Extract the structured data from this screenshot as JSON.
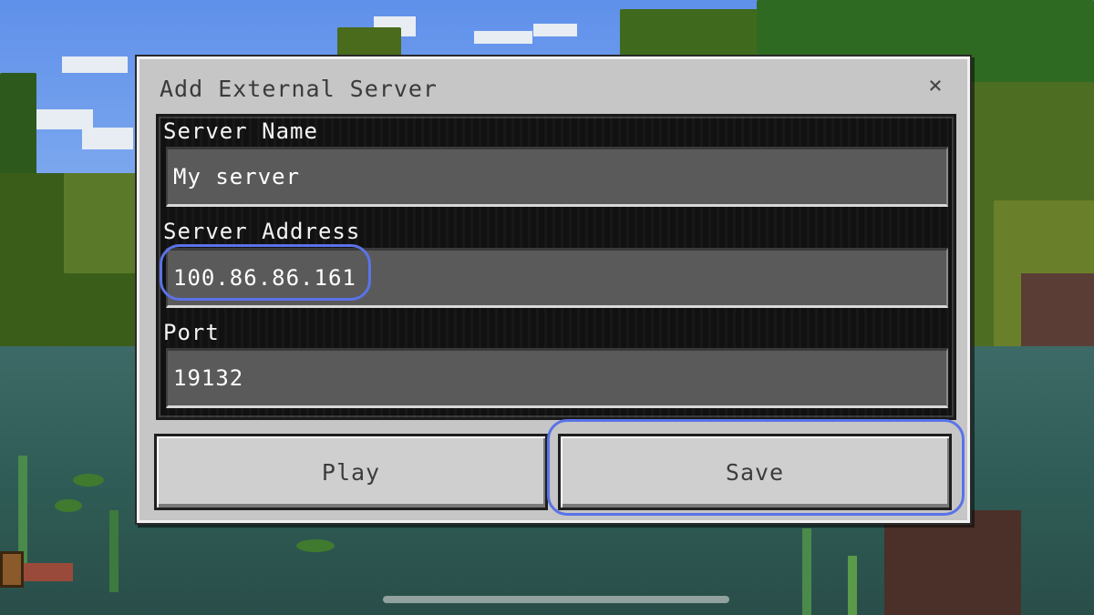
{
  "dialog": {
    "title": "Add External Server",
    "close_icon": "close-icon",
    "close_glyph": "×"
  },
  "fields": {
    "server_name": {
      "label": "Server Name",
      "value": "My server"
    },
    "server_address": {
      "label": "Server Address",
      "value": "100.86.86.161"
    },
    "port": {
      "label": "Port",
      "value": "19132"
    }
  },
  "buttons": {
    "play_label": "Play",
    "save_label": "Save"
  },
  "colors": {
    "highlight": "#5a73e8",
    "dialog_bg": "#c6c6c6",
    "panel_bg": "#111111",
    "input_bg": "#5a5a5a"
  }
}
